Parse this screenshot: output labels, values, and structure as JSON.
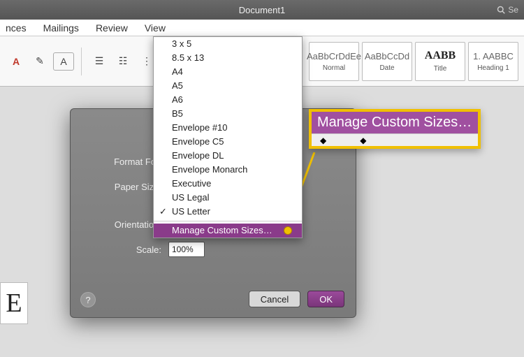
{
  "title": "Document1",
  "search_placeholder": "Se",
  "menu": {
    "items": [
      "nces",
      "Mailings",
      "Review",
      "View"
    ]
  },
  "ribbon": {
    "text_box": "A",
    "styles": [
      {
        "preview": "AaBbCrDdEe",
        "label": "Normal"
      },
      {
        "preview": "AaBbCcDd",
        "label": "Date"
      },
      {
        "preview": "AABB",
        "label": "Title"
      },
      {
        "preview": "1. AABBC",
        "label": "Heading 1"
      }
    ]
  },
  "doc_glyph": "E",
  "dialog": {
    "format_for_label": "Format For:",
    "paper_size_label": "Paper Size:",
    "orientation_label": "Orientation:",
    "scale_label": "Scale:",
    "scale_value": "100%",
    "help": "?",
    "cancel": "Cancel",
    "ok": "OK"
  },
  "popup_items": [
    "3 x 5",
    "8.5 x 13",
    "A4",
    "A5",
    "A6",
    "B5",
    "Envelope #10",
    "Envelope C5",
    "Envelope DL",
    "Envelope Monarch",
    "Executive",
    "US Legal",
    "US Letter"
  ],
  "popup_highlight": "Manage Custom Sizes…",
  "callout_text": "Manage Custom Sizes…"
}
